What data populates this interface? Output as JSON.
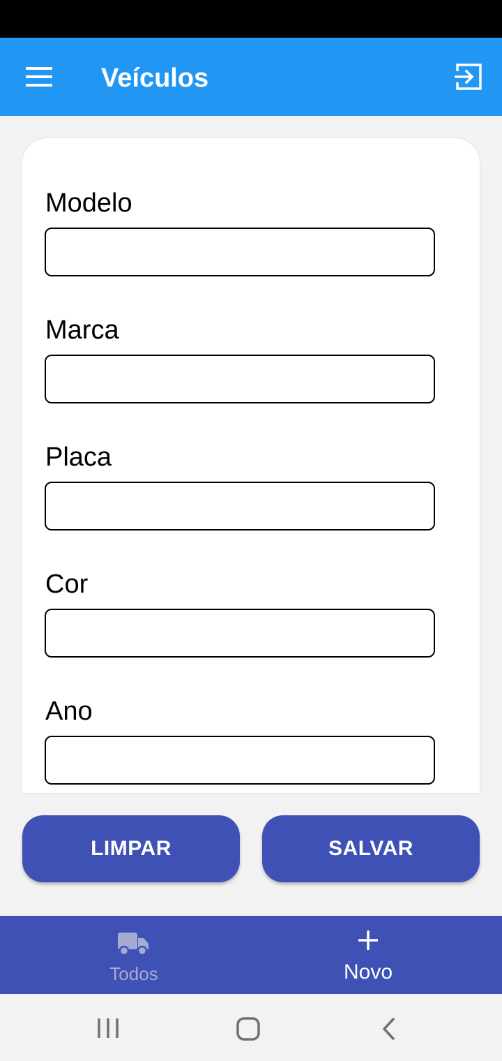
{
  "app_bar": {
    "title": "Veículos",
    "background": "#2196f3",
    "menu_icon": "menu-icon",
    "logout_icon": "logout-icon"
  },
  "form": {
    "fields": [
      {
        "label": "Modelo",
        "value": "",
        "placeholder": ""
      },
      {
        "label": "Marca",
        "value": "",
        "placeholder": ""
      },
      {
        "label": "Placa",
        "value": "",
        "placeholder": ""
      },
      {
        "label": "Cor",
        "value": "",
        "placeholder": ""
      },
      {
        "label": "Ano",
        "value": "",
        "placeholder": ""
      }
    ]
  },
  "actions": {
    "clear_label": "LIMPAR",
    "save_label": "SALVAR",
    "color": "#3f51b5"
  },
  "bottom_nav": {
    "items": [
      {
        "label": "Todos",
        "icon": "truck-icon",
        "active": false
      },
      {
        "label": "Novo",
        "icon": "plus-icon",
        "active": true
      }
    ],
    "background": "#3f51b5"
  },
  "system_nav": {
    "icons": [
      "recent-apps-icon",
      "home-icon",
      "back-icon"
    ]
  }
}
